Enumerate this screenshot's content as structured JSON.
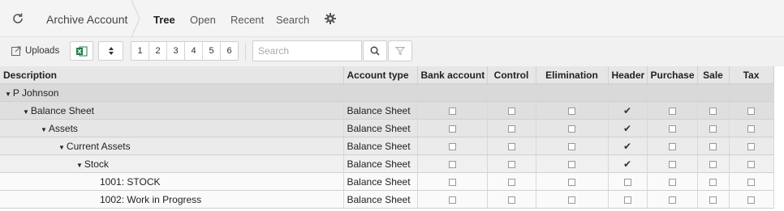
{
  "nav": {
    "app_title": "Archive Account",
    "links": [
      "Tree",
      "Open",
      "Recent",
      "Search"
    ],
    "active": "Tree"
  },
  "toolbar": {
    "uploads_label": "Uploads",
    "pages": [
      "1",
      "2",
      "3",
      "4",
      "5",
      "6"
    ],
    "search_placeholder": "Search"
  },
  "grid": {
    "columns": [
      "Description",
      "Account type",
      "Bank account",
      "Control",
      "Elimination",
      "Header",
      "Purchase",
      "Sale",
      "Tax"
    ],
    "rows": [
      {
        "description": "P Johnson",
        "caret": true,
        "account_type": "",
        "flags": null
      },
      {
        "description": "Balance Sheet",
        "caret": true,
        "account_type": "Balance Sheet",
        "flags": [
          false,
          false,
          false,
          true,
          false,
          false,
          false
        ]
      },
      {
        "description": "Assets",
        "caret": true,
        "account_type": "Balance Sheet",
        "flags": [
          false,
          false,
          false,
          true,
          false,
          false,
          false
        ]
      },
      {
        "description": "Current Assets",
        "caret": true,
        "account_type": "Balance Sheet",
        "flags": [
          false,
          false,
          false,
          true,
          false,
          false,
          false
        ]
      },
      {
        "description": "Stock",
        "caret": true,
        "account_type": "Balance Sheet",
        "flags": [
          false,
          false,
          false,
          true,
          false,
          false,
          false
        ]
      },
      {
        "description": "1001: STOCK",
        "caret": false,
        "account_type": "Balance Sheet",
        "flags": [
          false,
          false,
          false,
          false,
          false,
          false,
          false
        ]
      },
      {
        "description": "1002: Work in Progress",
        "caret": false,
        "account_type": "Balance Sheet",
        "flags": [
          false,
          false,
          false,
          false,
          false,
          false,
          false
        ]
      }
    ]
  },
  "colors": {
    "excel_green": "#1d7b45",
    "header_bg": "#e6e6e6"
  }
}
